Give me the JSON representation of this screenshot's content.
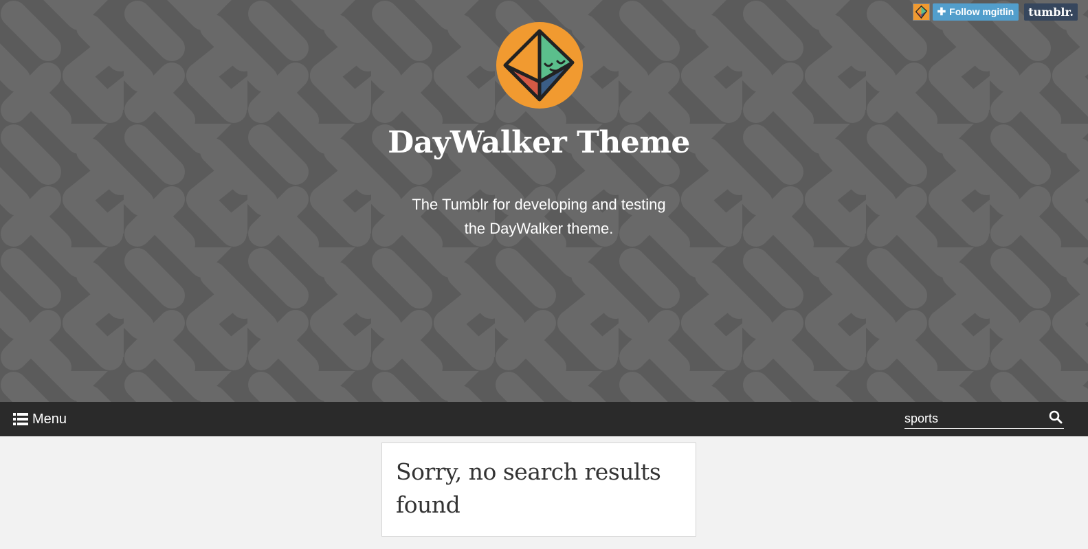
{
  "blog": {
    "title": "DayWalker Theme",
    "description": "The Tumblr for developing and testing the DayWalker theme."
  },
  "topbar": {
    "follow_label": "Follow mgitlin",
    "follow_icon": "plus-icon",
    "tumblr_label": "tumblr."
  },
  "nav": {
    "menu_label": "Menu",
    "menu_icon": "list-icon",
    "search_value": "sports",
    "search_icon": "search-icon"
  },
  "results": {
    "message": "Sorry, no search results found"
  },
  "colors": {
    "header_bg": "#5b5b5b",
    "pattern_stripe": "#696969",
    "navbar_bg": "#2a2a2a",
    "page_bg": "#f2f2f2",
    "follow_button": "#529ecc",
    "tumblr_button": "#36465d",
    "avatar_orange": "#f19a30",
    "avatar_green": "#5bbf8c",
    "avatar_blue": "#3b5e86",
    "avatar_red": "#d55a45"
  }
}
